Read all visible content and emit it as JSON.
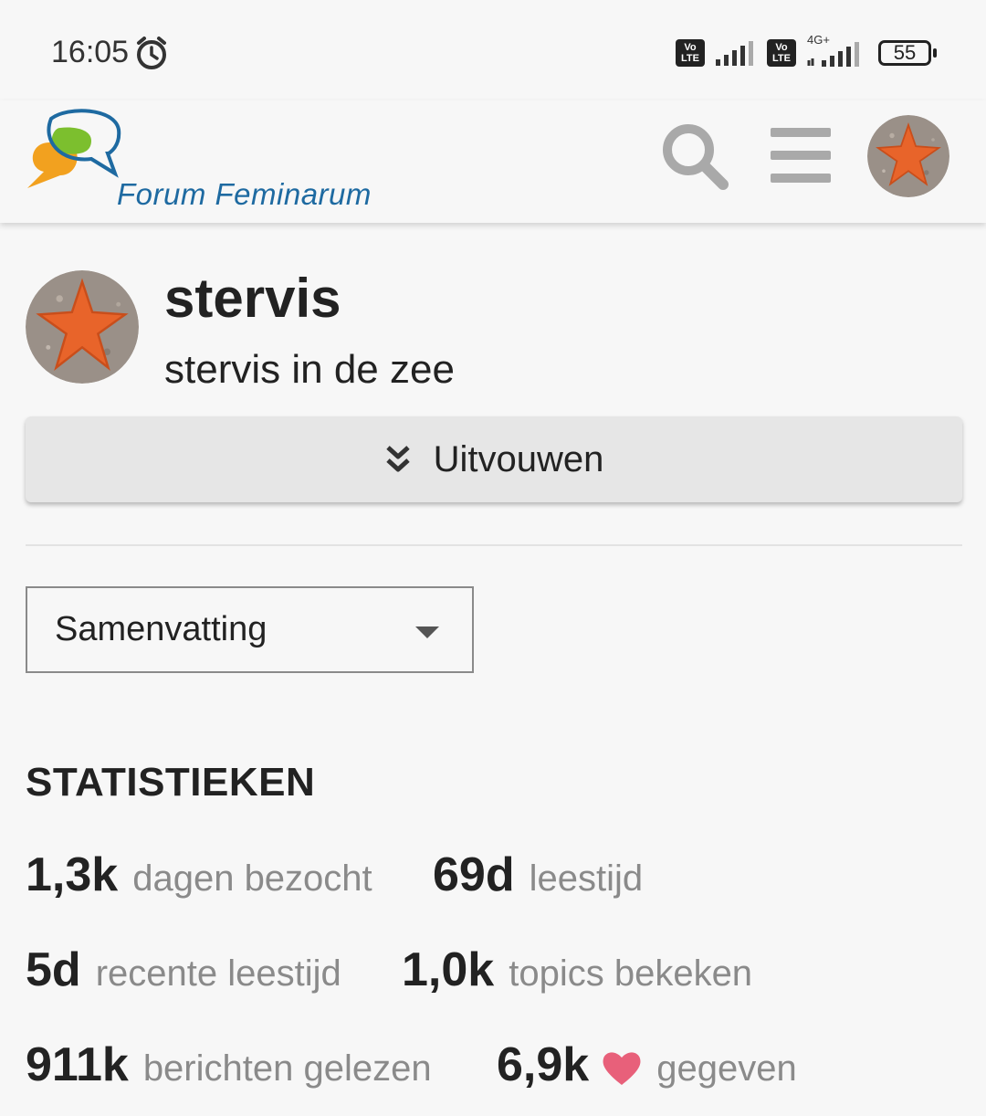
{
  "status_bar": {
    "time": "16:05",
    "volte_label": "Vo LTE",
    "network_label": "4G+",
    "battery": "55"
  },
  "header": {
    "logo_text": "Forum Feminarum",
    "colors": {
      "logo_blue": "#1e6aa1",
      "logo_green": "#7cbf2e",
      "logo_orange": "#f2a11f",
      "icon_gray": "#a9a9a9"
    },
    "icons": [
      "search-icon",
      "hamburger-menu-icon",
      "user-avatar"
    ]
  },
  "profile": {
    "username": "stervis",
    "title": "stervis in de zee",
    "expand_label": "Uitvouwen"
  },
  "view_select": {
    "value": "Samenvatting"
  },
  "stats": {
    "heading": "STATISTIEKEN",
    "items": [
      {
        "value": "1,3k",
        "label": "dagen bezocht"
      },
      {
        "value": "69d",
        "label": "leestijd"
      },
      {
        "value": "5d",
        "label": "recente leestijd"
      },
      {
        "value": "1,0k",
        "label": "topics bekeken"
      },
      {
        "value": "911k",
        "label": "berichten gelezen"
      },
      {
        "value": "6,9k",
        "label": "gegeven",
        "icon": "heart-icon"
      }
    ],
    "heart_color": "#e8607a"
  }
}
